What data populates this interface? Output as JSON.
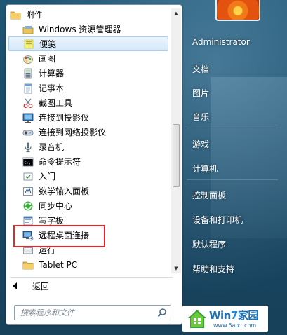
{
  "start_menu": {
    "programs": [
      {
        "label": "附件",
        "icon": "folder-icon",
        "level": 1,
        "name": "folder-accessories"
      },
      {
        "label": "Windows 资源管理器",
        "icon": "explorer-icon",
        "level": 2,
        "name": "program-explorer"
      },
      {
        "label": "便笺",
        "icon": "sticky-notes-icon",
        "level": 2,
        "name": "program-sticky-notes"
      },
      {
        "label": "画图",
        "icon": "paint-icon",
        "level": 2,
        "name": "program-paint"
      },
      {
        "label": "计算器",
        "icon": "calculator-icon",
        "level": 2,
        "name": "program-calculator"
      },
      {
        "label": "记事本",
        "icon": "notepad-icon",
        "level": 2,
        "name": "program-notepad"
      },
      {
        "label": "截图工具",
        "icon": "snipping-tool-icon",
        "level": 2,
        "name": "program-snipping-tool"
      },
      {
        "label": "连接到投影仪",
        "icon": "projector-icon",
        "level": 2,
        "name": "program-connect-projector"
      },
      {
        "label": "连接到网络投影仪",
        "icon": "network-projector-icon",
        "level": 2,
        "name": "program-connect-network-projector"
      },
      {
        "label": "录音机",
        "icon": "microphone-icon",
        "level": 2,
        "name": "program-sound-recorder"
      },
      {
        "label": "命令提示符",
        "icon": "command-prompt-icon",
        "level": 2,
        "name": "program-command-prompt"
      },
      {
        "label": "入门",
        "icon": "getting-started-icon",
        "level": 2,
        "name": "program-getting-started"
      },
      {
        "label": "数学输入面板",
        "icon": "math-input-icon",
        "level": 2,
        "name": "program-math-input"
      },
      {
        "label": "同步中心",
        "icon": "sync-center-icon",
        "level": 2,
        "name": "program-sync-center"
      },
      {
        "label": "写字板",
        "icon": "wordpad-icon",
        "level": 2,
        "name": "program-wordpad"
      },
      {
        "label": "远程桌面连接",
        "icon": "remote-desktop-icon",
        "level": 2,
        "name": "program-remote-desktop"
      },
      {
        "label": "运行",
        "icon": "run-icon",
        "level": 2,
        "name": "program-run"
      },
      {
        "label": "Tablet PC",
        "icon": "folder-icon",
        "level": 2,
        "name": "folder-tablet-pc"
      }
    ],
    "selected_index": 2,
    "highlighted_index": 15,
    "back_label": "返回",
    "search_placeholder": "搜索程序和文件"
  },
  "right_pane": {
    "user_name": "Administrator",
    "items": [
      "文档",
      "图片",
      "音乐",
      "游戏",
      "计算机",
      "控制面板",
      "设备和打印机",
      "默认程序",
      "帮助和支持"
    ]
  },
  "watermark": {
    "title_win": "Win",
    "title_7": "7",
    "title_jia": "家园",
    "url": "www.5aixt.com"
  },
  "colors": {
    "highlight_border": "#e2262a",
    "selected_bg": "#d5e8f9",
    "aero_bg": "#1a4a66"
  }
}
